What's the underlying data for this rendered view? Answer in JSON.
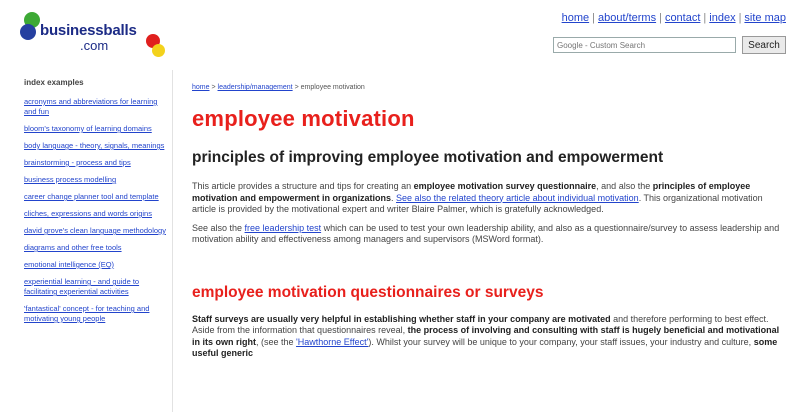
{
  "header": {
    "logo_text": "businessballs",
    "logo_sub": ".com",
    "links": [
      "home",
      "about/terms",
      "contact",
      "index",
      "site map"
    ],
    "search_placeholder": "Google - Custom Search",
    "search_button": "Search"
  },
  "sidebar": {
    "title": "index examples",
    "items": [
      "acronyms and abbreviations for learning and fun",
      "bloom's taxonomy of learning domains",
      "body language - theory, signals, meanings",
      "brainstorming - process and tips",
      "business process modelling",
      "career change planner tool and template",
      "cliches, expressions and words origins",
      "david grove's clean language methodology",
      "diagrams and other free tools",
      "emotional intelligence (EQ)",
      "experiential learning - and guide to facilitating experiential activities",
      "'fantastical' concept - for teaching and motivating young people"
    ]
  },
  "main": {
    "breadcrumb": {
      "home": "home",
      "section": "leadership/management",
      "sep": ">",
      "current": "employee motivation"
    },
    "title": "employee motivation",
    "subtitle": "principles of improving employee motivation and empowerment",
    "p1": {
      "t1": "This article provides a structure and tips for creating an ",
      "b1": "employee motivation survey questionnaire",
      "t2": ", and also the ",
      "b2": "principles of employee motivation and empowerment in organizations",
      "t3": ". ",
      "link": "See also the related theory article about individual motivation",
      "t4": ". This organizational motivation article is provided by the motivational expert and writer Blaire Palmer, which is gratefully acknowledged."
    },
    "p2": {
      "t1": "See also the ",
      "link": "free leadership test",
      "t2": " which can be used to test your own leadership ability, and also as a questionnaire/survey to assess leadership and motivation ability and effectiveness among managers and supervisors (MSWord format)."
    },
    "section_heading": "employee motivation questionnaires or surveys",
    "p3": {
      "b1": "Staff surveys are usually very helpful in establishing whether staff in your company are motivated",
      "t1": " and therefore performing to best effect. Aside from the information that questionnaires reveal, ",
      "b2": "the process of involving and consulting with staff is hugely beneficial and motivational in its own right",
      "t2": ", (see the ",
      "link": "'Hawthorne Effect'",
      "t3": "). Whilst your survey will be unique to your company, your staff issues, your industry and culture, ",
      "b3": "some useful generic"
    }
  }
}
